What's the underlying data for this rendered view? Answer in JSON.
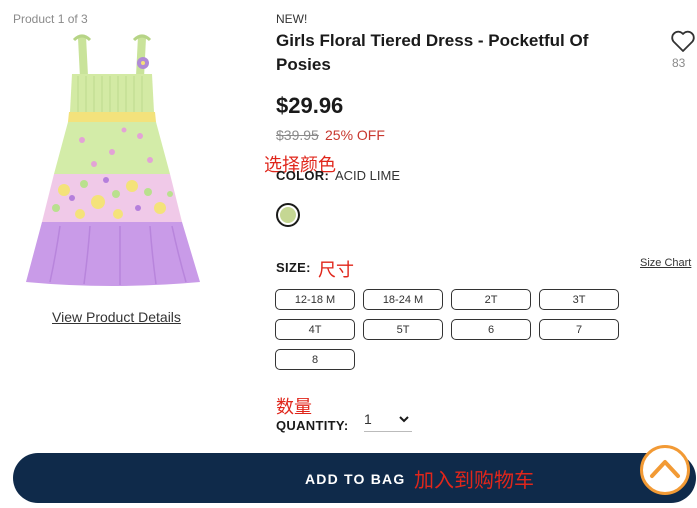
{
  "gallery": {
    "counter": "Product 1 of 3",
    "view_details": "View Product Details"
  },
  "product": {
    "badge": "NEW!",
    "title": "Girls Floral Tiered Dress - Pocketful Of Posies",
    "wishlist_icon": "heart-icon",
    "wishlist_count": "83",
    "price": "$29.96",
    "old_price": "$39.95",
    "discount": "25% OFF"
  },
  "color": {
    "label": "COLOR:",
    "value": "ACID LIME",
    "swatch_color": "#c5d793"
  },
  "size": {
    "label": "SIZE:",
    "chart_link": "Size Chart",
    "options": [
      "12-18 M",
      "18-24 M",
      "2T",
      "3T",
      "4T",
      "5T",
      "6",
      "7",
      "8"
    ]
  },
  "quantity": {
    "label": "QUANTITY:",
    "value": "1"
  },
  "cta": {
    "add_to_bag": "ADD TO BAG",
    "button_color": "#0f2a4a"
  },
  "annotations": {
    "color": "选择颜色",
    "size": "尺寸",
    "quantity": "数量",
    "add_to_bag": "加入到购物车"
  },
  "accent_color": "#f29a35"
}
